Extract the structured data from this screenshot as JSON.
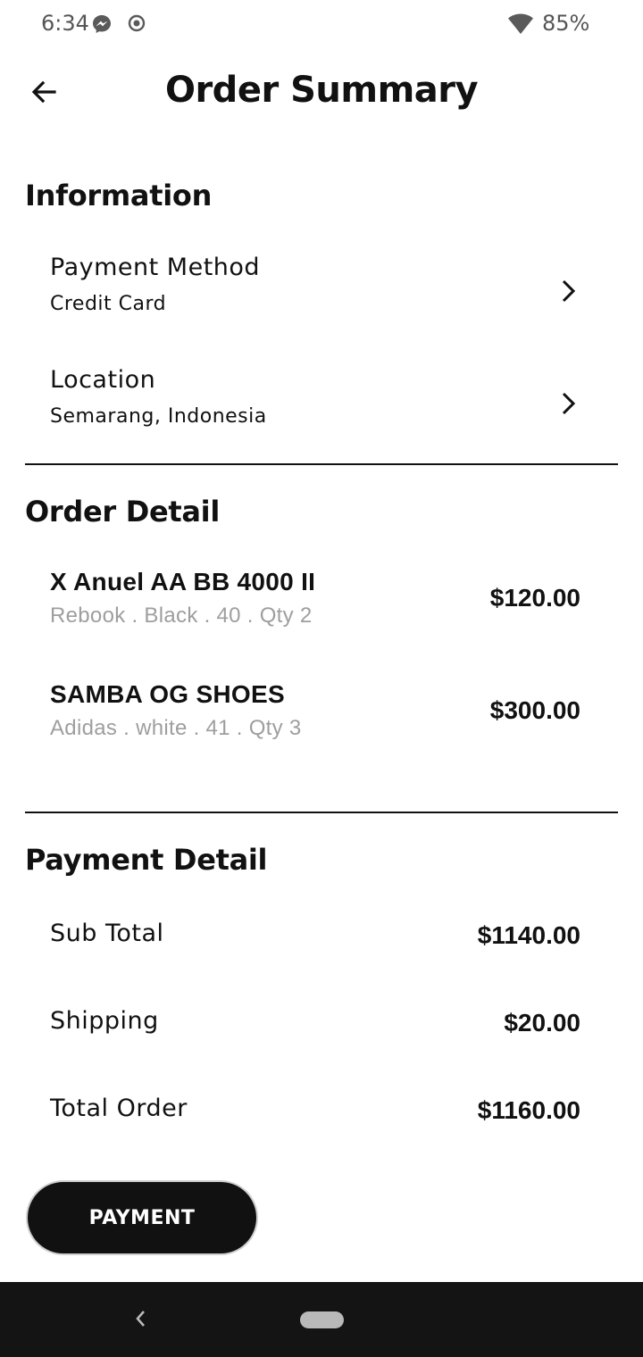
{
  "status_bar": {
    "time": "6:34",
    "battery": "85%",
    "icons": [
      "messenger-icon",
      "record-icon",
      "wifi-icon"
    ]
  },
  "header": {
    "title": "Order Summary",
    "back_icon": "arrow-left-icon"
  },
  "information": {
    "title": "Information",
    "items": [
      {
        "label": "Payment Method",
        "value": "Credit Card"
      },
      {
        "label": "Location",
        "value": "Semarang, Indonesia"
      }
    ]
  },
  "order_detail": {
    "title": "Order Detail",
    "items": [
      {
        "name": "X Anuel AA BB 4000 II",
        "meta": "Rebook . Black . 40 . Qty 2",
        "price": "$120.00"
      },
      {
        "name": "SAMBA OG SHOES",
        "meta": "Adidas . white . 41 . Qty 3",
        "price": "$300.00"
      }
    ]
  },
  "payment_detail": {
    "title": "Payment Detail",
    "rows": [
      {
        "label": "Sub Total",
        "value": "$1140.00"
      },
      {
        "label": "Shipping",
        "value": "$20.00"
      },
      {
        "label": "Total Order",
        "value": "$1160.00"
      }
    ]
  },
  "actions": {
    "payment_label": "PAYMENT"
  },
  "colors": {
    "primary": "#111111",
    "muted_text": "#9e9e9e",
    "nav_bar": "#141414"
  }
}
